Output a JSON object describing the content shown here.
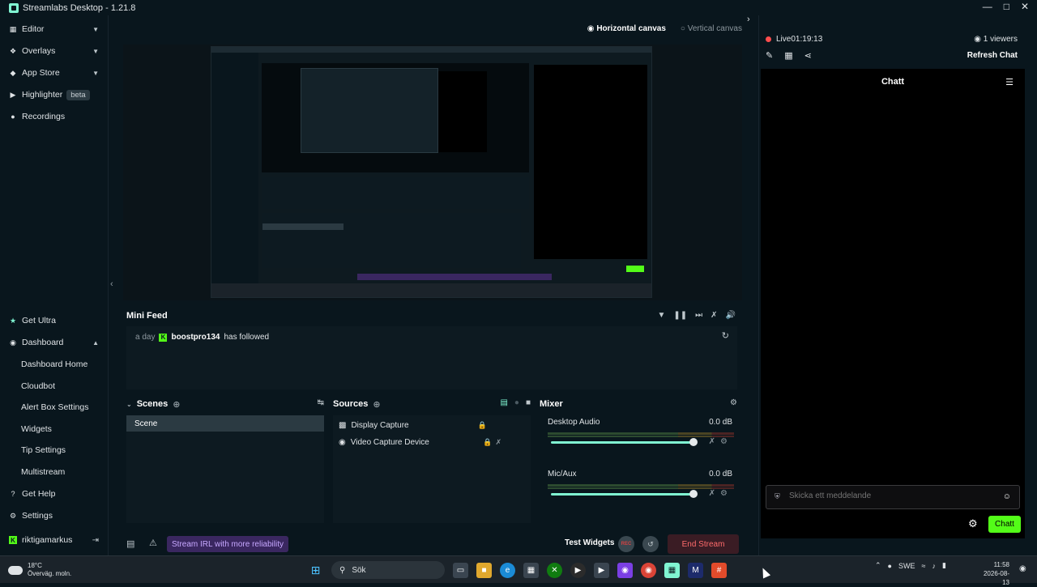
{
  "app": {
    "title": "Streamlabs Desktop - 1.21.8"
  },
  "nav": {
    "top": [
      {
        "label": "Editor",
        "icon": "editor-icon"
      },
      {
        "label": "Overlays",
        "icon": "overlays-icon"
      },
      {
        "label": "App Store",
        "icon": "app-store-icon"
      },
      {
        "label": "Highlighter",
        "icon": "highlighter-icon",
        "badge": "beta"
      },
      {
        "label": "Recordings",
        "icon": "recordings-icon"
      }
    ],
    "bottom": [
      {
        "label": "Get Ultra",
        "icon": "ultra-icon"
      },
      {
        "label": "Dashboard",
        "icon": "dashboard-icon"
      },
      {
        "label": "Dashboard Home"
      },
      {
        "label": "Cloudbot"
      },
      {
        "label": "Alert Box Settings"
      },
      {
        "label": "Widgets"
      },
      {
        "label": "Tip Settings"
      },
      {
        "label": "Multistream"
      },
      {
        "label": "Get Help",
        "icon": "help-icon"
      },
      {
        "label": "Settings",
        "icon": "settings-icon"
      },
      {
        "label": "riktigamarkus",
        "icon": "kick-icon"
      }
    ]
  },
  "canvas": {
    "horizontal": "Horizontal canvas",
    "vertical": "Vertical canvas"
  },
  "minifeed": {
    "title": "Mini Feed",
    "event": {
      "time": "a day",
      "user": "boostpro134",
      "action": "has followed"
    }
  },
  "scenes": {
    "title": "Scenes",
    "items": [
      "Scene"
    ]
  },
  "sources": {
    "title": "Sources",
    "items": [
      "Display Capture",
      "Video Capture Device"
    ]
  },
  "mixer": {
    "title": "Mixer",
    "channels": [
      {
        "name": "Desktop Audio",
        "db": "0.0 dB",
        "volume": 1.0
      },
      {
        "name": "Mic/Aux",
        "db": "0.0 dB",
        "volume": 1.0
      }
    ]
  },
  "footer": {
    "irl": "Stream IRL with more reliability",
    "test_widgets": "Test Widgets",
    "rec": "REC",
    "end_stream": "End Stream"
  },
  "chat": {
    "live": "Live",
    "uptime": "01:19:13",
    "viewers": "1 viewers",
    "refresh": "Refresh Chat",
    "title": "Chatt",
    "placeholder": "Skicka ett meddelande",
    "send": "Chatt"
  },
  "taskbar": {
    "weather_temp": "18°C",
    "weather_desc": "Överväg. moln.",
    "search": "Sök",
    "lang": "SWE",
    "time": "11:58",
    "date": "2026-08-13"
  },
  "colors": {
    "accent": "#80f5d2",
    "kick": "#53fc18",
    "live": "#ff4d4d",
    "end": "#ff6b6b"
  }
}
